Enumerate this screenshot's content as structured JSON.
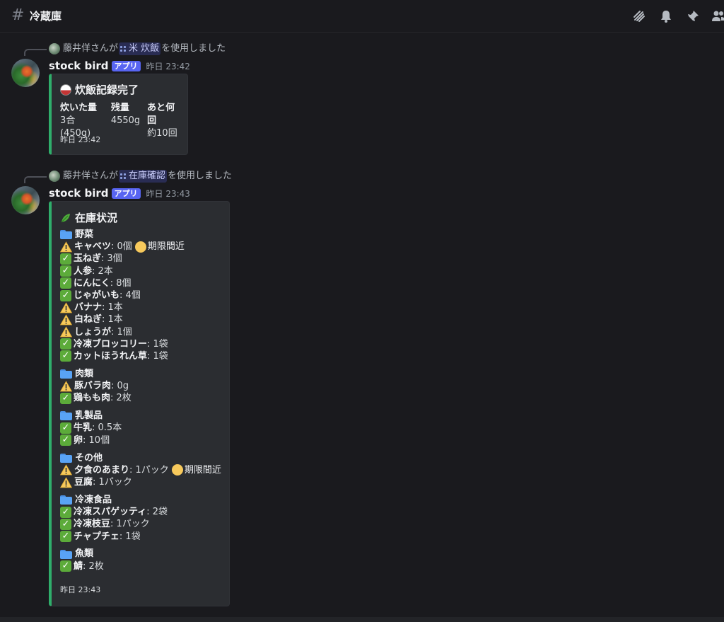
{
  "header": {
    "channel": "冷蔵庫"
  },
  "messages": [
    {
      "reply": {
        "user": "藤井佯",
        "text_before": "さんが",
        "command": "米 炊飯",
        "text_after": "を使用しました"
      },
      "author": "stock bird",
      "badge": "アプリ",
      "time": "昨日 23:42",
      "embed": {
        "title": "炊飯記録完了",
        "fields": [
          {
            "name": "炊いた量",
            "value": "3合 (450g)"
          },
          {
            "name": "残量",
            "value": "4550g"
          },
          {
            "name": "あと何回",
            "value": "約10回"
          }
        ],
        "footer": "昨日 23:42"
      }
    },
    {
      "reply": {
        "user": "藤井佯",
        "text_before": "さんが",
        "command": "在庫確認",
        "text_after": "を使用しました"
      },
      "author": "stock bird",
      "badge": "アプリ",
      "time": "昨日 23:43",
      "embed": {
        "title": "在庫状況",
        "footer": "昨日 23:43",
        "categories": [
          {
            "name": "野菜",
            "items": [
              {
                "status": "warn",
                "name": "キャベツ",
                "qty": ": 0個",
                "note": "期限間近"
              },
              {
                "status": "ok",
                "name": "玉ねぎ",
                "qty": ": 3個"
              },
              {
                "status": "ok",
                "name": "人参",
                "qty": ": 2本"
              },
              {
                "status": "ok",
                "name": "にんにく",
                "qty": ": 8個"
              },
              {
                "status": "ok",
                "name": "じゃがいも",
                "qty": ": 4個"
              },
              {
                "status": "warn",
                "name": "バナナ",
                "qty": ": 1本"
              },
              {
                "status": "warn",
                "name": "白ねぎ",
                "qty": ": 1本"
              },
              {
                "status": "warn",
                "name": "しょうが",
                "qty": ": 1個"
              },
              {
                "status": "ok",
                "name": "冷凍ブロッコリー",
                "qty": ": 1袋"
              },
              {
                "status": "ok",
                "name": "カットほうれん草",
                "qty": ": 1袋"
              }
            ]
          },
          {
            "name": "肉類",
            "items": [
              {
                "status": "warn",
                "name": "豚バラ肉",
                "qty": ": 0g"
              },
              {
                "status": "ok",
                "name": "鶏もも肉",
                "qty": ": 2枚"
              }
            ]
          },
          {
            "name": "乳製品",
            "items": [
              {
                "status": "ok",
                "name": "牛乳",
                "qty": ": 0.5本"
              },
              {
                "status": "ok",
                "name": "卵",
                "qty": ": 10個"
              }
            ]
          },
          {
            "name": "その他",
            "items": [
              {
                "status": "warn",
                "name": "夕食のあまり",
                "qty": ": 1パック",
                "note": "期限間近"
              },
              {
                "status": "warn",
                "name": "豆腐",
                "qty": ": 1パック"
              }
            ]
          },
          {
            "name": "冷凍食品",
            "items": [
              {
                "status": "ok",
                "name": "冷凍スパゲッティ",
                "qty": ": 2袋"
              },
              {
                "status": "ok",
                "name": "冷凍枝豆",
                "qty": ": 1パック"
              },
              {
                "status": "ok",
                "name": "チャプチェ",
                "qty": ": 1袋"
              }
            ]
          },
          {
            "name": "魚類",
            "items": [
              {
                "status": "ok",
                "name": "鯖",
                "qty": ": 2枚"
              }
            ]
          }
        ]
      }
    }
  ],
  "colors": {
    "accent": "#2fae6b",
    "badge": "#5865f2",
    "background": "#1a1a1e",
    "embed": "#2b2d31"
  },
  "icons": [
    "threads-icon",
    "bell-icon",
    "pin-icon",
    "members-icon"
  ]
}
